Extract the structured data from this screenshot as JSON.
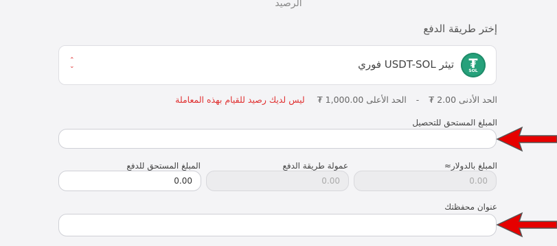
{
  "header": {
    "balance_label": "الرصيد"
  },
  "payment": {
    "section_title": "إختر طريقة الدفع",
    "method_name": "تيثر USDT-SOL فوري",
    "logo_text": "₮",
    "logo_subtext": "SOL",
    "min_limit": "الحد الأدنى 2.00 ₮",
    "separator": "-",
    "max_limit": "الحد الأعلى 1,000.00 ₮",
    "error_message": "ليس لديك رصيد للقيام بهذه المعاملة"
  },
  "fields": {
    "amount_due_label": "المبلغ المستحق للتحصيل",
    "amount_due_value": "",
    "usd_amount_label": "المبلغ بالدولار≈",
    "usd_amount_value": "0.00",
    "fee_label": "عمولة طريقة الدفع",
    "fee_value": "0.00",
    "pay_amount_label": "المبلغ المستحق للدفع",
    "pay_amount_value": "0.00",
    "wallet_label": "عنوان محفظتك",
    "wallet_value": ""
  },
  "colors": {
    "accent_red": "#e03131",
    "tether_green": "#26a17b",
    "annotation_arrow": "#e60000"
  },
  "icons": {
    "sort": "sort-updown-icon",
    "logo": "tether-sol-logo-icon"
  }
}
